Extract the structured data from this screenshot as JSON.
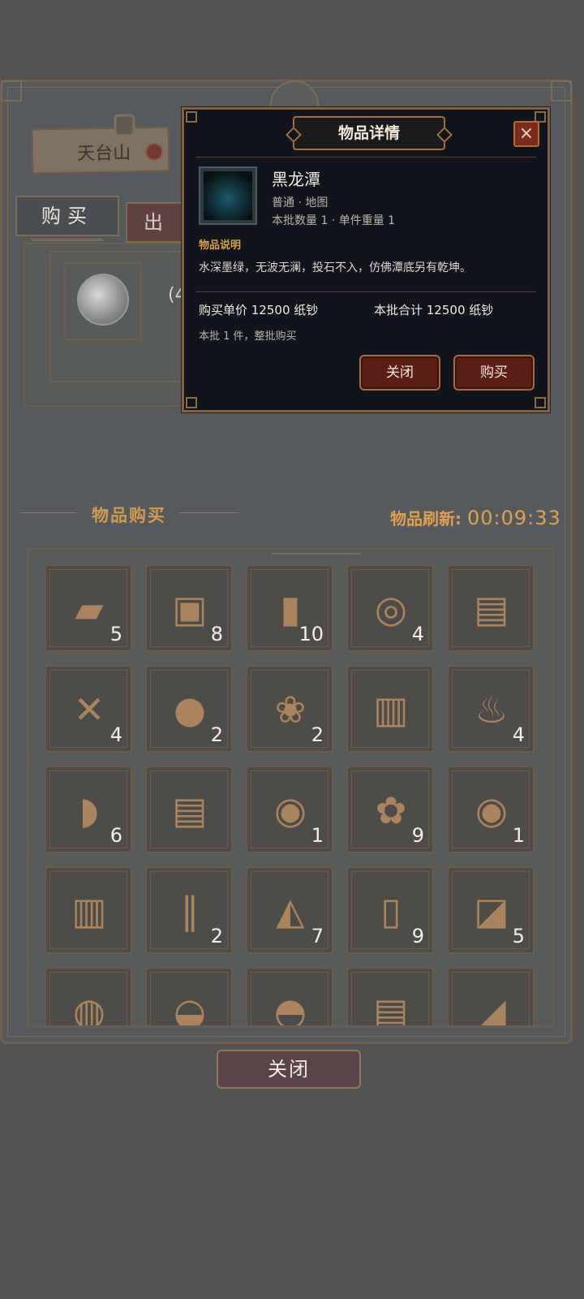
{
  "location": {
    "name": "天台山"
  },
  "tabs": {
    "buy": "购买",
    "sell": "出"
  },
  "currency": {
    "count_text": "(4"
  },
  "section": {
    "title": "物品购买",
    "refresh_label": "物品刷新:",
    "refresh_timer": "00:09:33"
  },
  "grid": {
    "items": [
      {
        "icon": "tattered-cloth-icon",
        "glyph": "▰",
        "qty": "5"
      },
      {
        "icon": "wooden-block-icon",
        "glyph": "▣",
        "qty": "8"
      },
      {
        "icon": "log-icon",
        "glyph": "▮",
        "qty": "10"
      },
      {
        "icon": "rope-coil-icon",
        "glyph": "◎",
        "qty": "4"
      },
      {
        "icon": "scripture-book-icon",
        "glyph": "▤",
        "qty": ""
      },
      {
        "icon": "bone-icon",
        "glyph": "✕",
        "qty": "4"
      },
      {
        "icon": "porcelain-jar-icon",
        "glyph": "●",
        "qty": "2"
      },
      {
        "icon": "pearl-box-icon",
        "glyph": "❀",
        "qty": "2"
      },
      {
        "icon": "dark-book-icon",
        "glyph": "▥",
        "qty": ""
      },
      {
        "icon": "incense-burner-icon",
        "glyph": "♨",
        "qty": "4"
      },
      {
        "icon": "cloth-bundle-icon",
        "glyph": "◗",
        "qty": "6"
      },
      {
        "icon": "old-book-icon",
        "glyph": "▤",
        "qty": ""
      },
      {
        "icon": "fire-orb-icon",
        "glyph": "◉",
        "qty": "1"
      },
      {
        "icon": "herb-leaves-icon",
        "glyph": "✿",
        "qty": "9"
      },
      {
        "icon": "fire-orb-icon",
        "glyph": "◉",
        "qty": "1"
      },
      {
        "icon": "blue-book-icon",
        "glyph": "▥",
        "qty": ""
      },
      {
        "icon": "red-sticks-icon",
        "glyph": "∥",
        "qty": "2"
      },
      {
        "icon": "grain-sack-icon",
        "glyph": "◭",
        "qty": "7"
      },
      {
        "icon": "medicine-jar-icon",
        "glyph": "▯",
        "qty": "9"
      },
      {
        "icon": "paper-scroll-icon",
        "glyph": "◪",
        "qty": "5"
      },
      {
        "icon": "thread-spool-icon",
        "glyph": "◍",
        "qty": ""
      },
      {
        "icon": "cloth-sack-icon",
        "glyph": "◒",
        "qty": ""
      },
      {
        "icon": "dark-bowl-icon",
        "glyph": "◓",
        "qty": ""
      },
      {
        "icon": "manual-book-icon",
        "glyph": "▤",
        "qty": ""
      },
      {
        "icon": "dark-cloth-icon",
        "glyph": "◢",
        "qty": ""
      }
    ]
  },
  "footer": {
    "close_label": "关闭"
  },
  "dialog": {
    "title": "物品详情",
    "close_icon": "×",
    "item_name": "黑龙潭",
    "item_type": "普通 · 地图",
    "item_batch": "本批数量 1 · 单件重量 1",
    "desc_title": "物品说明",
    "desc_text": "水深墨绿，无波无澜，投石不入，仿佛潭底另有乾坤。",
    "unit_price": "购买单价 12500 纸钞",
    "total_price": "本批合计 12500 纸钞",
    "batch_note": "本批 1 件，整批购买",
    "close_button": "关闭",
    "buy_button": "购买"
  }
}
